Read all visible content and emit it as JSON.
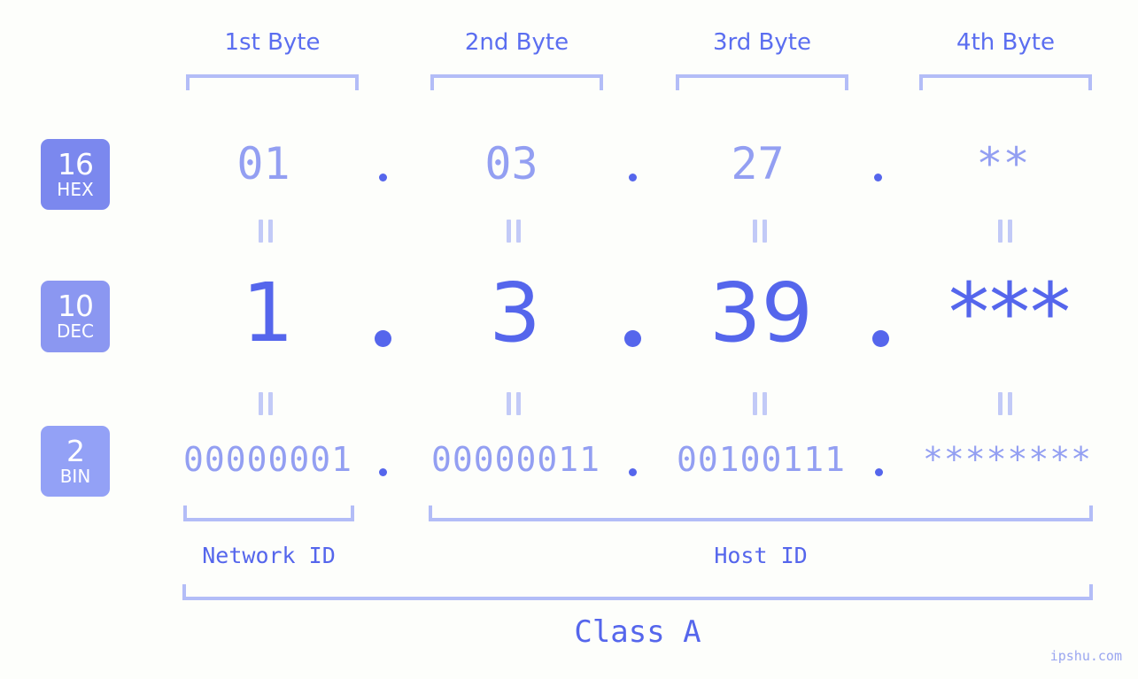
{
  "meta": {
    "colors": {
      "background": "#fdfefb",
      "accent_strong": "#5566ec",
      "accent_mid": "#939ff2",
      "accent_light": "#b3bdf7",
      "badge_hex": "#7b88ee",
      "badge_dec": "#8b97f1",
      "badge_bin": "#93a1f6",
      "badge_text": "#ffffff"
    },
    "watermark": "ipshu.com"
  },
  "headers": {
    "bytes": [
      {
        "label": "1st Byte"
      },
      {
        "label": "2nd Byte"
      },
      {
        "label": "3rd Byte"
      },
      {
        "label": "4th Byte"
      }
    ]
  },
  "radix_badges": [
    {
      "number": "16",
      "name": "HEX"
    },
    {
      "number": "10",
      "name": "DEC"
    },
    {
      "number": "2",
      "name": "BIN"
    }
  ],
  "rows": {
    "hex": {
      "radix": "16",
      "radix_name": "HEX",
      "values": [
        "01",
        "03",
        "27",
        "**"
      ],
      "separator": "."
    },
    "dec": {
      "radix": "10",
      "radix_name": "DEC",
      "values": [
        "1",
        "3",
        "39",
        "***"
      ],
      "separator": "."
    },
    "bin": {
      "radix": "2",
      "radix_name": "BIN",
      "values": [
        "00000001",
        "00000011",
        "00100111",
        "********"
      ],
      "separator": "."
    }
  },
  "equals_marks": {
    "symbol": "=",
    "count_per_gap": 4,
    "gaps": 2
  },
  "segments": {
    "network_id": {
      "label": "Network ID"
    },
    "host_id": {
      "label": "Host ID"
    },
    "class": {
      "label": "Class A"
    }
  }
}
